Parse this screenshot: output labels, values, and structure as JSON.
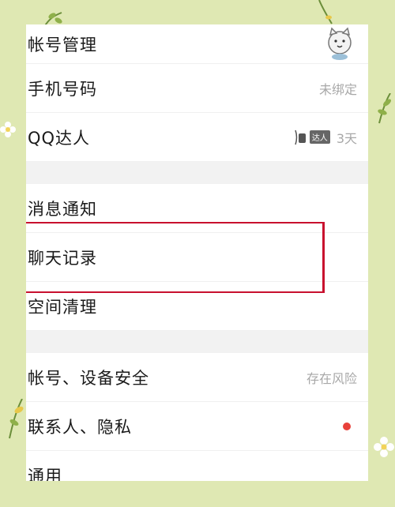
{
  "menu": {
    "account_manage": "帐号管理",
    "phone": {
      "label": "手机号码",
      "value": "未绑定"
    },
    "qq_daren": {
      "label": "QQ达人",
      "badge": "达人",
      "days": "3天"
    },
    "notifications": "消息通知",
    "chat_history": "聊天记录",
    "space_clean": "空间清理",
    "security": {
      "label": "帐号、设备安全",
      "value": "存在风险"
    },
    "privacy": "联系人、隐私",
    "general": "通用"
  },
  "colors": {
    "background": "#dfe8b3",
    "highlight_border": "#c8102e",
    "red_dot": "#e8413a"
  },
  "icons": [
    "avatar-cat-icon",
    "qq-daren-badge-icon",
    "leaf-icon",
    "flower-icon"
  ]
}
